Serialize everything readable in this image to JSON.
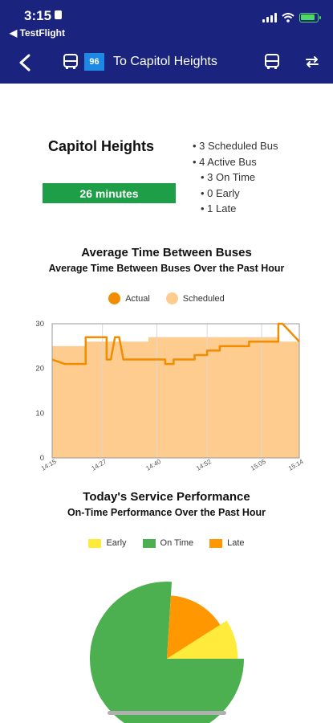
{
  "status_bar": {
    "time": "3:15",
    "back_app": "TestFlight"
  },
  "nav": {
    "route_number": "96",
    "title": "To Capitol Heights"
  },
  "summary": {
    "stop_name": "Capitol Heights",
    "eta": "26 minutes",
    "stats": [
      {
        "label": "• 3 Scheduled Bus",
        "indent": false
      },
      {
        "label": "• 4 Active Bus",
        "indent": false
      },
      {
        "label": "• 3 On Time",
        "indent": true
      },
      {
        "label": "• 0 Early",
        "indent": true
      },
      {
        "label": "• 1 Late",
        "indent": true
      }
    ]
  },
  "colors": {
    "header_bg": "#1a237e",
    "eta_green": "#1e9e46",
    "actual": "#f28c00",
    "scheduled": "#ffcc8f",
    "early": "#ffeb3b",
    "on_time": "#4caf50",
    "late": "#ff9800"
  },
  "chart_data": [
    {
      "type": "area",
      "title": "Average Time Between Buses",
      "subtitle": "Average Time Between Buses Over the Past Hour",
      "legend": [
        "Actual",
        "Scheduled"
      ],
      "legend_position": "top",
      "x_ticks": [
        "14:15",
        "14:27",
        "14:40",
        "14:52",
        "15:05",
        "15:14"
      ],
      "y_ticks": [
        0,
        10,
        20,
        30
      ],
      "ylim": [
        0,
        30
      ],
      "grid": "vertical",
      "series": [
        {
          "name": "Actual",
          "style": "line",
          "points": [
            [
              "14:15",
              22
            ],
            [
              "14:18",
              21
            ],
            [
              "14:23",
              21
            ],
            [
              "14:23",
              27
            ],
            [
              "14:27",
              27
            ],
            [
              "14:28",
              27
            ],
            [
              "14:28",
              22
            ],
            [
              "14:29",
              22
            ],
            [
              "14:30",
              27
            ],
            [
              "14:31",
              27
            ],
            [
              "14:32",
              22
            ],
            [
              "14:42",
              22
            ],
            [
              "14:42",
              21
            ],
            [
              "14:44",
              21
            ],
            [
              "14:44",
              22
            ],
            [
              "14:49",
              22
            ],
            [
              "14:49",
              23
            ],
            [
              "14:52",
              23
            ],
            [
              "14:52",
              24
            ],
            [
              "14:55",
              24
            ],
            [
              "14:55",
              25
            ],
            [
              "15:02",
              25
            ],
            [
              "15:02",
              26
            ],
            [
              "15:05",
              26
            ],
            [
              "15:09",
              26
            ],
            [
              "15:09",
              30
            ],
            [
              "15:10",
              30
            ],
            [
              "15:12",
              28
            ],
            [
              "15:13",
              27
            ],
            [
              "15:14",
              26
            ]
          ]
        },
        {
          "name": "Scheduled",
          "style": "area",
          "points": [
            [
              "14:15",
              25
            ],
            [
              "14:23",
              25
            ],
            [
              "14:23",
              26
            ],
            [
              "14:38",
              26
            ],
            [
              "14:38",
              27
            ],
            [
              "15:09",
              27
            ],
            [
              "15:09",
              26
            ],
            [
              "15:14",
              26
            ]
          ]
        }
      ]
    },
    {
      "type": "pie",
      "title": "Today's Service Performance",
      "subtitle": "On-Time Performance Over the Past Hour",
      "legend": [
        "Early",
        "On Time",
        "Late"
      ],
      "legend_position": "top",
      "series": [
        {
          "values": [
            {
              "label": "On Time",
              "value": 76
            },
            {
              "label": "Late",
              "value": 15
            },
            {
              "label": "Early",
              "value": 9
            }
          ]
        }
      ]
    }
  ]
}
